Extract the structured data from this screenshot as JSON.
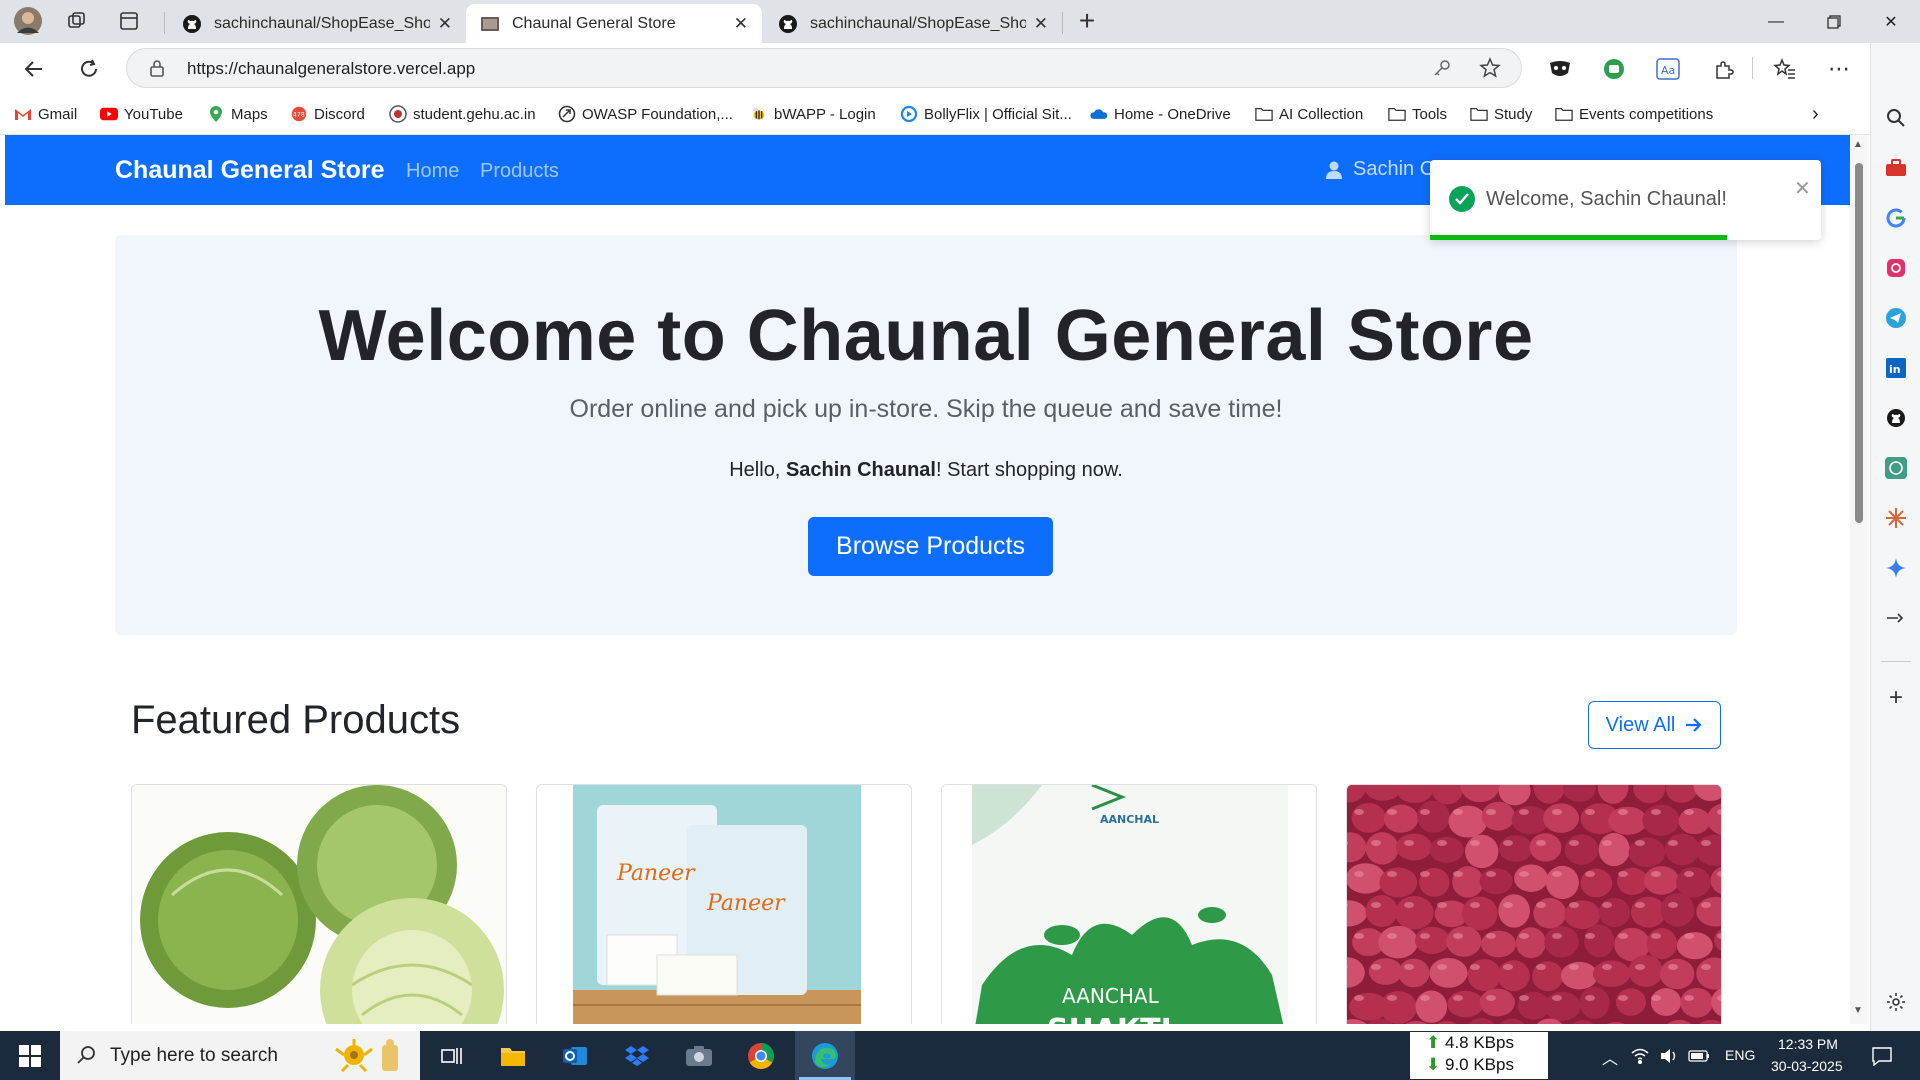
{
  "browser": {
    "tabs": [
      {
        "title": "sachinchaunal/ShopEase_ShopMa",
        "active": false
      },
      {
        "title": "Chaunal General Store",
        "active": true
      },
      {
        "title": "sachinchaunal/ShopEase_ShopMa",
        "active": false
      }
    ],
    "url": "https://chaunalgeneralstore.vercel.app",
    "bookmarks": [
      {
        "label": "Gmail",
        "icon": "gmail-icon"
      },
      {
        "label": "YouTube",
        "icon": "youtube-icon"
      },
      {
        "label": "Maps",
        "icon": "maps-icon"
      },
      {
        "label": "Discord",
        "icon": "discord-icon"
      },
      {
        "label": "student.gehu.ac.in",
        "icon": "university-icon"
      },
      {
        "label": "OWASP Foundation,...",
        "icon": "owasp-icon"
      },
      {
        "label": "bWAPP - Login",
        "icon": "bee-icon"
      },
      {
        "label": "BollyFlix | Official Sit...",
        "icon": "bollyflix-icon"
      },
      {
        "label": "Home - OneDrive",
        "icon": "onedrive-icon"
      },
      {
        "label": "AI Collection",
        "icon": "folder-icon"
      },
      {
        "label": "Tools",
        "icon": "folder-icon"
      },
      {
        "label": "Study",
        "icon": "folder-icon"
      },
      {
        "label": "Events competitions",
        "icon": "folder-icon"
      }
    ],
    "discord_badge": "478"
  },
  "site": {
    "brand": "Chaunal General Store",
    "nav": [
      "Home",
      "Products"
    ],
    "user": "Sachin C",
    "hero": {
      "title": "Welcome to Chaunal General Store",
      "subtitle": "Order online and pick up in-store. Skip the queue and save time!",
      "hello_prefix": "Hello, ",
      "hello_name": "Sachin Chaunal",
      "hello_suffix": "! Start shopping now.",
      "button": "Browse Products"
    },
    "featured": {
      "title": "Featured Products",
      "view_all": "View All",
      "cards": [
        {
          "image": "cabbage"
        },
        {
          "image": "paneer",
          "label": "Paneer"
        },
        {
          "image": "milk",
          "brand": "AANCHAL",
          "text1": "AANCHAL",
          "text2": "SHAKTI"
        },
        {
          "image": "onion"
        }
      ]
    },
    "toast": {
      "message": "Welcome, Sachin Chaunal!",
      "progress": 0.76
    }
  },
  "taskbar": {
    "search_placeholder": "Type here to search",
    "net_up": "4.8 KBps",
    "net_down": "9.0 KBps",
    "lang": "ENG",
    "time": "12:33 PM",
    "date": "30-03-2025"
  },
  "colors": {
    "primary": "#0d6efd",
    "success": "#07bc0c",
    "taskbar": "#1b2a3d"
  }
}
